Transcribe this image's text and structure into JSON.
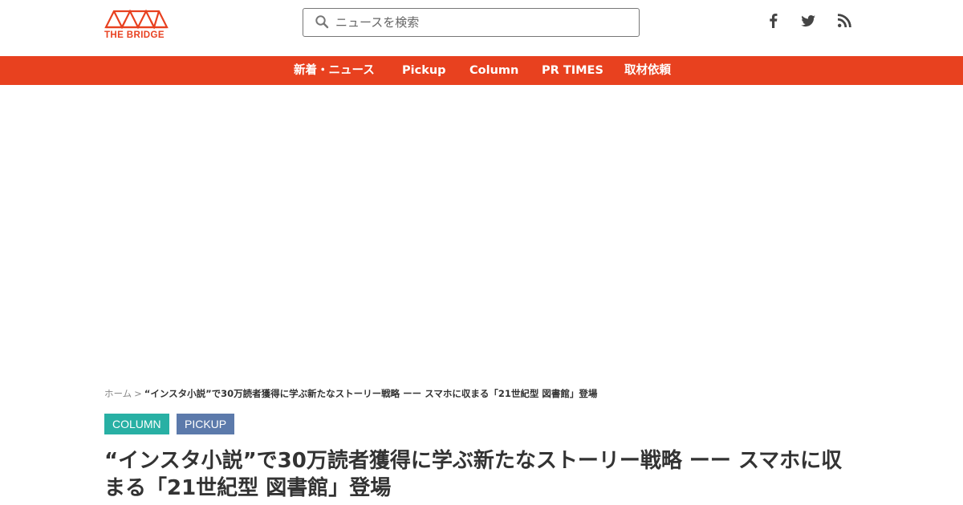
{
  "header": {
    "logo_text": "THE BRIDGE",
    "search": {
      "placeholder": "ニュースを検索",
      "value": ""
    },
    "social_icons": [
      "facebook-icon",
      "twitter-icon",
      "rss-icon"
    ]
  },
  "nav": {
    "items": [
      {
        "label": "新着・ニュース"
      },
      {
        "label": "Pickup"
      },
      {
        "label": "Column"
      },
      {
        "label": "PR TIMES"
      },
      {
        "label": "取材依頼"
      }
    ]
  },
  "breadcrumb": {
    "home": "ホーム",
    "separator": ">",
    "current": "“インスタ小説”で30万読者獲得に学ぶ新たなストーリー戦略 ーー スマホに収まる「21世紀型 図書館」登場"
  },
  "article": {
    "tags": [
      {
        "label": "COLUMN"
      },
      {
        "label": "PICKUP"
      }
    ],
    "title": "“インスタ小説”で30万読者獲得に学ぶ新たなストーリー戦略 ーー スマホに収まる「21世紀型 図書館」登場"
  },
  "colors": {
    "brand": "#e8411f",
    "tag_column": "#28b0a4",
    "tag_pickup": "#5c7aab",
    "text": "#333333",
    "muted": "#888888"
  }
}
